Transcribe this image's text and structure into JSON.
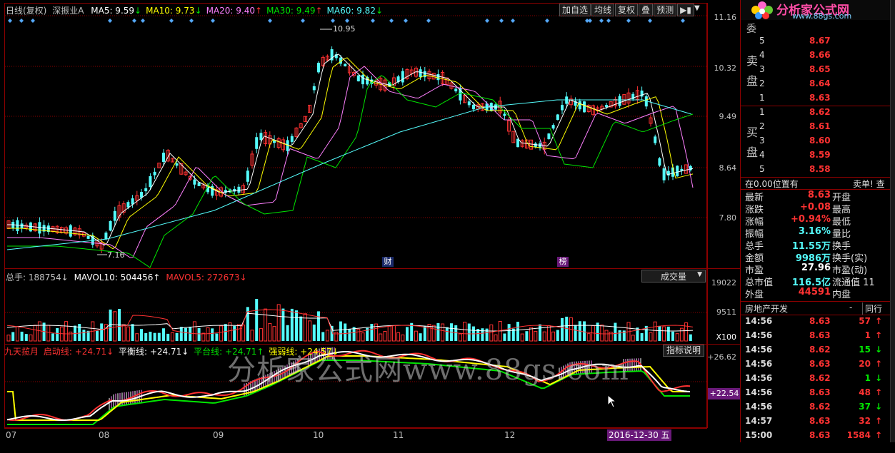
{
  "header": {
    "chart_mode": "日线(复权)",
    "stock_name": "深振业A",
    "ma": [
      {
        "label": "MA5: 9.59",
        "arrow": "↓",
        "color": "#ffffff"
      },
      {
        "label": "MA10: 9.73",
        "arrow": "↓",
        "color": "#ffff00"
      },
      {
        "label": "MA20: 9.40",
        "arrow": "↑",
        "color": "#ff80ff"
      },
      {
        "label": "MA30: 9.49",
        "arrow": "↑",
        "color": "#00e600"
      },
      {
        "label": "MA60: 9.82",
        "arrow": "↓",
        "color": "#54fcfc"
      }
    ],
    "toolbar": [
      "加自选",
      "均线",
      "复权",
      "叠",
      "预测",
      "▶▮"
    ]
  },
  "logo": {
    "title": "分析家公式网",
    "url": "www.88gs.com"
  },
  "price_axis": [
    "11.16",
    "10.32",
    "9.49",
    "8.64",
    "7.80"
  ],
  "annotations": {
    "high": "10.95",
    "low": "7.16",
    "fin_marker": "财",
    "rank_marker": "榜"
  },
  "volume": {
    "title": "总手: 188754↓",
    "mavol10": "MAVOL10: 504456↑",
    "mavol5": "MAVOL5: 272673↓",
    "dropdown": "成交量",
    "axis": [
      "19022",
      "9511",
      "X100"
    ]
  },
  "indicator": {
    "name": "九天揽月",
    "l1": "启动线: +24.71↓",
    "l2": "平衡线: +24.71↓",
    "l3": "平台线: +24.71↑",
    "l4": "强弱线: +24.57↓",
    "help": "指标说明",
    "axis_top": "+26.62",
    "axis_mid": "+22.54"
  },
  "watermark": "分析家公式网www.88gs.com",
  "date_axis": [
    "07",
    "08",
    "09",
    "10",
    "11",
    "12"
  ],
  "date_highlight": "2016-12-30 五",
  "order_book": {
    "top_label": "委",
    "sell_label": [
      "卖",
      "盘"
    ],
    "buy_label": [
      "买",
      "盘"
    ],
    "sells": [
      {
        "level": "5",
        "price": "8.67"
      },
      {
        "level": "4",
        "price": "8.66"
      },
      {
        "level": "3",
        "price": "8.65"
      },
      {
        "level": "2",
        "price": "8.64"
      },
      {
        "level": "1",
        "price": "8.63"
      }
    ],
    "buys": [
      {
        "level": "1",
        "price": "8.62"
      },
      {
        "level": "2",
        "price": "8.61"
      },
      {
        "level": "3",
        "price": "8.60"
      },
      {
        "level": "4",
        "price": "8.59"
      },
      {
        "level": "5",
        "price": "8.58"
      }
    ],
    "position": "在0.00位置有",
    "sell_order": "卖单! 查"
  },
  "stats": [
    {
      "l": "最新",
      "v": "8.63",
      "vc": "red",
      "r": "开盘"
    },
    {
      "l": "涨跌",
      "v": "+0.08",
      "vc": "red",
      "r": "最高"
    },
    {
      "l": "涨幅",
      "v": "+0.94%",
      "vc": "red",
      "r": "最低"
    },
    {
      "l": "振幅",
      "v": "3.16%",
      "vc": "cyan",
      "r": "量比"
    },
    {
      "l": "总手",
      "v": "11.55万",
      "vc": "cyan",
      "r": "换手"
    },
    {
      "l": "金额",
      "v": "9986万",
      "vc": "cyan",
      "r": "换手(实)"
    },
    {
      "l": "市盈",
      "v": "27.96",
      "vc": "white",
      "r": "市盈(动)"
    },
    {
      "l": "总市值",
      "v": "116.5亿",
      "vc": "cyan",
      "r": "流通值 11"
    },
    {
      "l": "外盘",
      "v": "44591",
      "vc": "red",
      "r": "内盘"
    }
  ],
  "sector": {
    "name": "房地产开发",
    "dash": "-",
    "peer": "同行"
  },
  "ticks": [
    {
      "t": "14:56",
      "p": "8.63",
      "v": "57",
      "d": "up"
    },
    {
      "t": "14:56",
      "p": "8.63",
      "v": "1",
      "d": "up"
    },
    {
      "t": "14:56",
      "p": "8.62",
      "v": "15",
      "d": "down"
    },
    {
      "t": "14:56",
      "p": "8.63",
      "v": "20",
      "d": "up"
    },
    {
      "t": "14:56",
      "p": "8.62",
      "v": "1",
      "d": "down"
    },
    {
      "t": "14:56",
      "p": "8.63",
      "v": "48",
      "d": "up"
    },
    {
      "t": "14:56",
      "p": "8.62",
      "v": "37",
      "d": "down"
    },
    {
      "t": "14:57",
      "p": "8.63",
      "v": "32",
      "d": "up"
    },
    {
      "t": "15:00",
      "p": "8.63",
      "v": "1584",
      "d": "up"
    }
  ],
  "colors": {
    "up": "#ff3232",
    "down": "#54fcfc",
    "grid": "#8b0000",
    "ma5": "#ffffff",
    "ma10": "#ffff00",
    "ma20": "#ff80ff",
    "ma30": "#00e600",
    "ma60": "#54fcfc"
  }
}
